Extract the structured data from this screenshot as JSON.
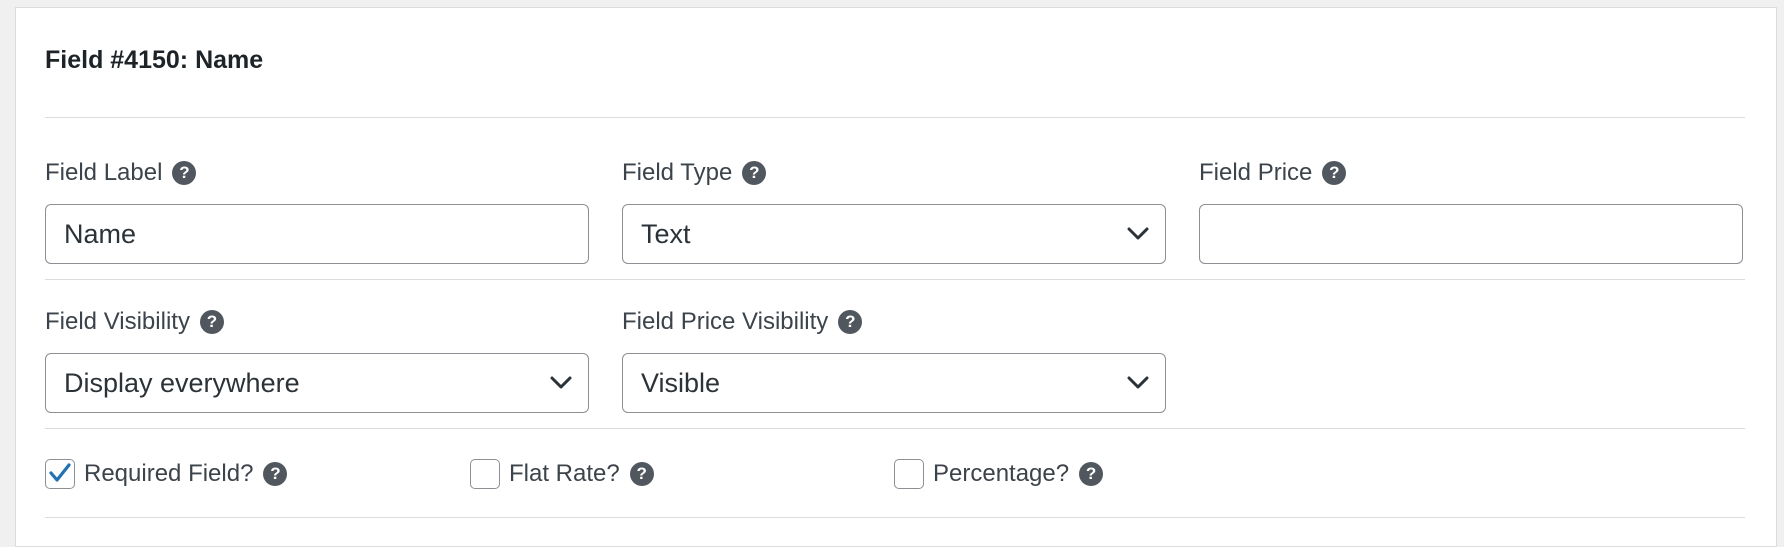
{
  "field": {
    "title": "Field #4150: Name"
  },
  "field_label": {
    "label": "Field Label",
    "value": "Name",
    "help_icon": "question-circle-icon"
  },
  "field_type": {
    "label": "Field Type",
    "selected": "Text",
    "help_icon": "question-circle-icon"
  },
  "field_price": {
    "label": "Field Price",
    "value": "",
    "help_icon": "question-circle-icon"
  },
  "field_visibility": {
    "label": "Field Visibility",
    "selected": "Display everywhere",
    "help_icon": "question-circle-icon"
  },
  "field_price_visibility": {
    "label": "Field Price Visibility",
    "selected": "Visible",
    "help_icon": "question-circle-icon"
  },
  "options": {
    "required": {
      "label": "Required Field?",
      "checked": true
    },
    "flat_rate": {
      "label": "Flat Rate?",
      "checked": false
    },
    "percentage": {
      "label": "Percentage?",
      "checked": false
    }
  },
  "colors": {
    "checkmark": "#2271b1",
    "help_icon_bg": "#50575e",
    "border": "#8c8f94",
    "divider": "#dcdcde"
  }
}
